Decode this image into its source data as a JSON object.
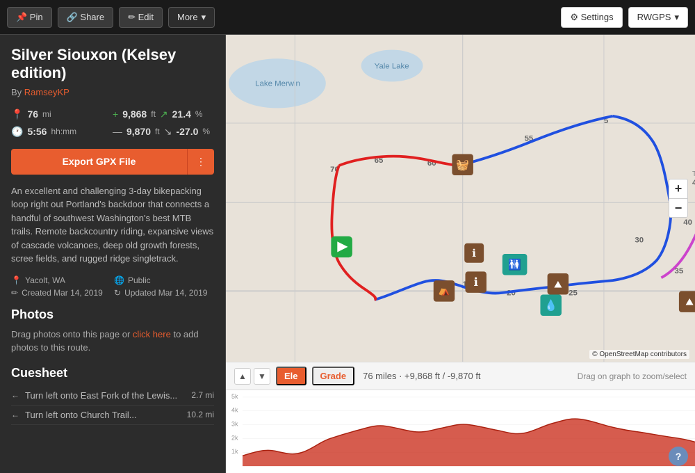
{
  "topbar": {
    "pin_label": "📌 Pin",
    "share_label": "🔗 Share",
    "edit_label": "✏ Edit",
    "more_label": "More",
    "settings_label": "⚙ Settings",
    "rwgps_label": "RWGPS"
  },
  "route": {
    "title": "Silver Siouxon (Kelsey edition)",
    "author_prefix": "By",
    "author_name": "RamseyKP",
    "distance_value": "76",
    "distance_unit": "mi",
    "time_value": "5:56",
    "time_unit": "hh:mm",
    "elevation_gain_value": "9,868",
    "elevation_gain_unit": "ft",
    "elevation_gain_percent": "21.4",
    "elevation_loss_value": "9,870",
    "elevation_loss_unit": "ft",
    "elevation_loss_percent": "-27.0",
    "description": "An excellent and challenging 3-day bikepacking loop right out Portland's backdoor that connects a handful of southwest Washington's best MTB trails. Remote backcountry riding, expansive views of cascade volcanoes, deep old growth forests, scree fields, and rugged ridge singletrack.",
    "location": "Yacolt, WA",
    "visibility": "Public",
    "created": "Created Mar 14, 2019",
    "updated": "Updated Mar 14, 2019",
    "export_label": "Export GPX File"
  },
  "photos": {
    "title": "Photos",
    "desc_prefix": "Drag photos onto this page or",
    "link_text": "click here",
    "desc_suffix": "to add photos to this route."
  },
  "cuesheet": {
    "title": "Cuesheet",
    "items": [
      {
        "direction": "←",
        "text": "Turn left onto East Fork of the Lewis...",
        "dist": "2.7 mi"
      },
      {
        "direction": "←",
        "text": "Turn left onto Church Trail...",
        "dist": "10.2 mi"
      }
    ]
  },
  "elevation": {
    "ele_label": "Ele",
    "grade_label": "Grade",
    "info": "76 miles · +9,868 ft / -9,870 ft",
    "instruction": "Drag on graph to zoom/select",
    "y_labels": [
      "5k",
      "4k",
      "3k",
      "2k",
      "1k"
    ]
  },
  "map": {
    "attribution": "© OpenStreetMap contributors"
  }
}
